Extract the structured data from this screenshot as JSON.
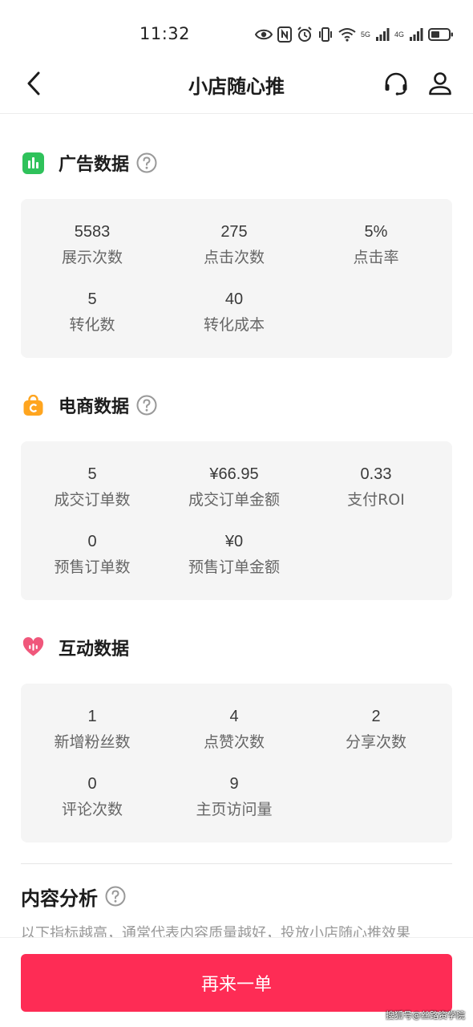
{
  "status_bar": {
    "time": "11:32",
    "net_5g": "5G",
    "net_4g": "4G"
  },
  "nav": {
    "title": "小店随心推"
  },
  "ad_data": {
    "title": "广告数据",
    "metrics": [
      {
        "value": "5583",
        "label": "展示次数"
      },
      {
        "value": "275",
        "label": "点击次数"
      },
      {
        "value": "5%",
        "label": "点击率"
      },
      {
        "value": "5",
        "label": "转化数"
      },
      {
        "value": "40",
        "label": "转化成本"
      }
    ]
  },
  "ecommerce_data": {
    "title": "电商数据",
    "metrics": [
      {
        "value": "5",
        "label": "成交订单数"
      },
      {
        "value": "¥66.95",
        "label": "成交订单金额"
      },
      {
        "value": "0.33",
        "label": "支付ROI"
      },
      {
        "value": "0",
        "label": "预售订单数"
      },
      {
        "value": "¥0",
        "label": "预售订单金额"
      }
    ]
  },
  "interaction_data": {
    "title": "互动数据",
    "metrics": [
      {
        "value": "1",
        "label": "新增粉丝数"
      },
      {
        "value": "4",
        "label": "点赞次数"
      },
      {
        "value": "2",
        "label": "分享次数"
      },
      {
        "value": "0",
        "label": "评论次数"
      },
      {
        "value": "9",
        "label": "主页访问量"
      }
    ]
  },
  "content_analysis": {
    "title": "内容分析",
    "description": "以下指标越高，通常代表内容质量越好，投放小店随心推效果"
  },
  "bottom": {
    "cta_label": "再来一单",
    "watermark": "搜狐号@丝路资学院"
  },
  "colors": {
    "accent": "#fe2c55",
    "ad_icon": "#2fc25b",
    "ecommerce_icon": "#ffa51f",
    "interaction_icon": "#f0577b",
    "card_bg": "#f5f5f5"
  },
  "icons": {
    "back": "chevron-left-icon",
    "support": "headset-icon",
    "profile": "user-icon",
    "ad_section": "bar-chart-icon",
    "ecommerce_section": "shopping-bag-icon",
    "interaction_section": "heart-icon",
    "help": "question-circle-icon"
  }
}
